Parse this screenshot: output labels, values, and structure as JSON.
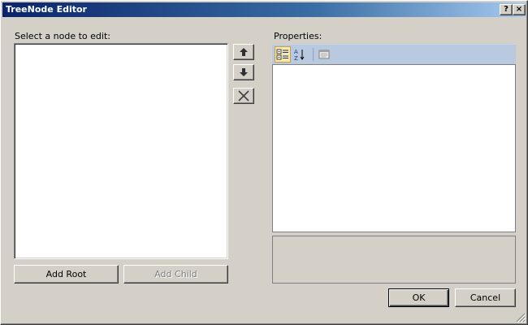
{
  "window": {
    "title": "TreeNode Editor"
  },
  "titlebar": {
    "help_label": "?",
    "close_label": "×"
  },
  "tree": {
    "label": "Select a node to edit:"
  },
  "properties": {
    "label": "Properties:"
  },
  "buttons": {
    "add_root": "Add Root",
    "add_child": "Add Child",
    "ok": "OK",
    "cancel": "Cancel"
  },
  "icons": {
    "move_up": "arrow-up-icon",
    "move_down": "arrow-down-icon",
    "delete": "delete-icon",
    "categorized": "categorized-icon",
    "alphabetical": "alphabetical-icon",
    "property_pages": "property-pages-icon"
  },
  "colors": {
    "title_start": "#0a246a",
    "title_end": "#a6caf0",
    "toolstrip": "#b9c9e0",
    "dialog": "#d4d0c8"
  }
}
